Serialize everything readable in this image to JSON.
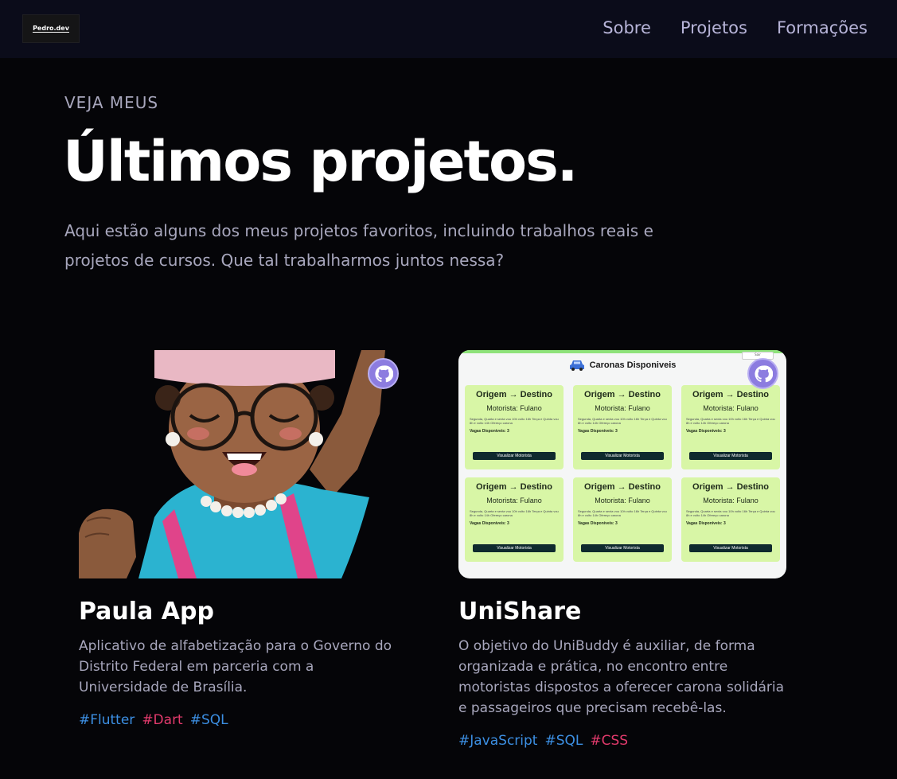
{
  "nav": {
    "logo_text": "Pedro.dev",
    "links": [
      "Sobre",
      "Projetos",
      "Formações"
    ]
  },
  "hero": {
    "eyebrow": "VEJA MEUS",
    "title": "Últimos projetos.",
    "intro": "Aqui estão alguns dos meus projetos favoritos, incluindo trabalhos reais e projetos de cursos. Que tal trabalharmos juntos nessa?"
  },
  "projects": [
    {
      "name": "Paula App",
      "description": "Aplicativo de alfabetização para o Governo do Distrito Federal em parceria com a Universidade de Brasília.",
      "tags": [
        {
          "label": "#Flutter",
          "color": "#3c8fe3"
        },
        {
          "label": "#Dart",
          "color": "#e23a6c"
        },
        {
          "label": "#SQL",
          "color": "#3c8fe3"
        }
      ],
      "icon": "github-icon"
    },
    {
      "name": "UniShare",
      "description": "O objetivo do UniBuddy é auxiliar, de forma organizada e prática, no encontro entre motoristas dispostos a oferecer carona solidária e passageiros que precisam recebê-las.",
      "tags": [
        {
          "label": "#JavaScript",
          "color": "#3c8fe3"
        },
        {
          "label": "#SQL",
          "color": "#3c8fe3"
        },
        {
          "label": "#CSS",
          "color": "#e23a6c"
        }
      ],
      "icon": "github-icon",
      "preview": {
        "header": "Caronas Disponiveis",
        "top_button": "Sair",
        "card_title": "Origem → Destino",
        "card_driver": "Motorista: Fulano",
        "card_body": "Segunda, Quarta e sexta vou 10h volto 16h Terça e Quinta vou 8h e volto 14h Ofereço carona",
        "card_vagas": "Vagas Disponíveis: 3",
        "card_button": "Visualizar Motorista"
      }
    }
  ],
  "colors": {
    "background": "#050508",
    "nav_background": "#0b0c1a",
    "accent_purple": "#8c7ce0",
    "tag_blue": "#3c8fe3",
    "tag_pink": "#e23a6c"
  }
}
